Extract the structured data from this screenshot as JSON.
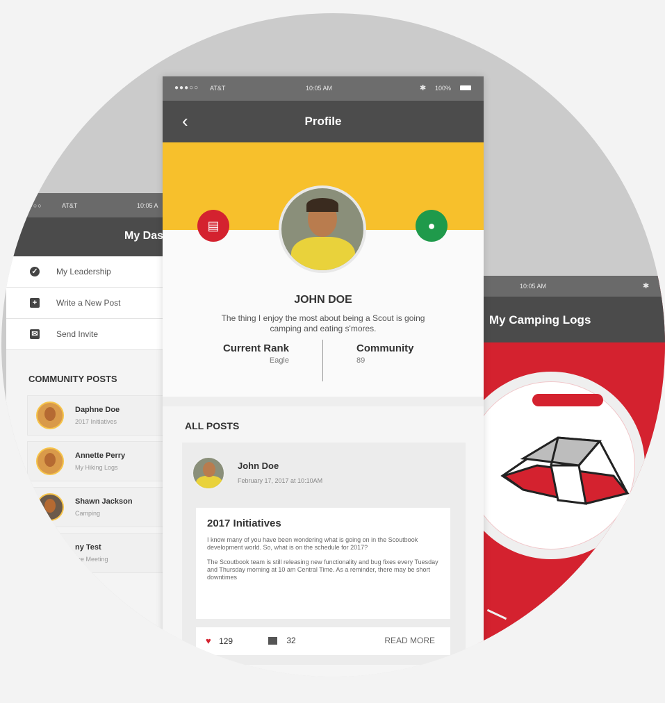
{
  "dashboard": {
    "status_carrier": "AT&T",
    "status_time": "10:05 A",
    "title": "My Dash",
    "menu": [
      {
        "label": "My Leadership",
        "icon": "shield-check-icon"
      },
      {
        "label": "Write a New Post",
        "icon": "plus-square-icon"
      },
      {
        "label": "Send Invite",
        "icon": "envelope-icon"
      }
    ],
    "section_title": "COMMUNITY POSTS",
    "posts": [
      {
        "name": "Daphne Doe",
        "sub": "2017 Initiatives"
      },
      {
        "name": "Annette Perry",
        "sub": "My Hiking Logs"
      },
      {
        "name": "Shawn Jackson",
        "sub": "Camping"
      },
      {
        "name": "ny Test",
        "sub": "ree Meeting"
      }
    ]
  },
  "profile": {
    "status_carrier": "AT&T",
    "status_time": "10:05 AM",
    "status_battery": "100%",
    "title": "Profile",
    "back_icon": "chevron-left-icon",
    "name": "JOHN DOE",
    "bio": "The thing I enjoy the most about being a Scout is going camping and eating s'mores.",
    "stats": {
      "rank_label": "Current Rank",
      "rank_value": "Eagle",
      "community_label": "Community",
      "community_value": "89"
    },
    "posts_title": "ALL POSTS",
    "post": {
      "author": "John Doe",
      "date": "February 17, 2017 at 10:10AM",
      "title": "2017 Initiatives",
      "paragraph1": "I know many of you have been wondering what is going on in the Scoutbook development world. So, what is on the schedule for 2017?",
      "paragraph2": "The Scoutbook team is still releasing new functionality and bug fixes every Tuesday and Thursday morning at 10 am Central Time. As a reminder, there may be short downtimes",
      "likes": "129",
      "comments": "32",
      "read_more": "READ MORE"
    }
  },
  "camping": {
    "status_time": "10:05 AM",
    "title": "My Camping Logs"
  },
  "colors": {
    "accent_yellow": "#f7c02c",
    "accent_red": "#d4222f",
    "accent_green": "#1f9a4b",
    "navbar": "#4b4b4b"
  }
}
